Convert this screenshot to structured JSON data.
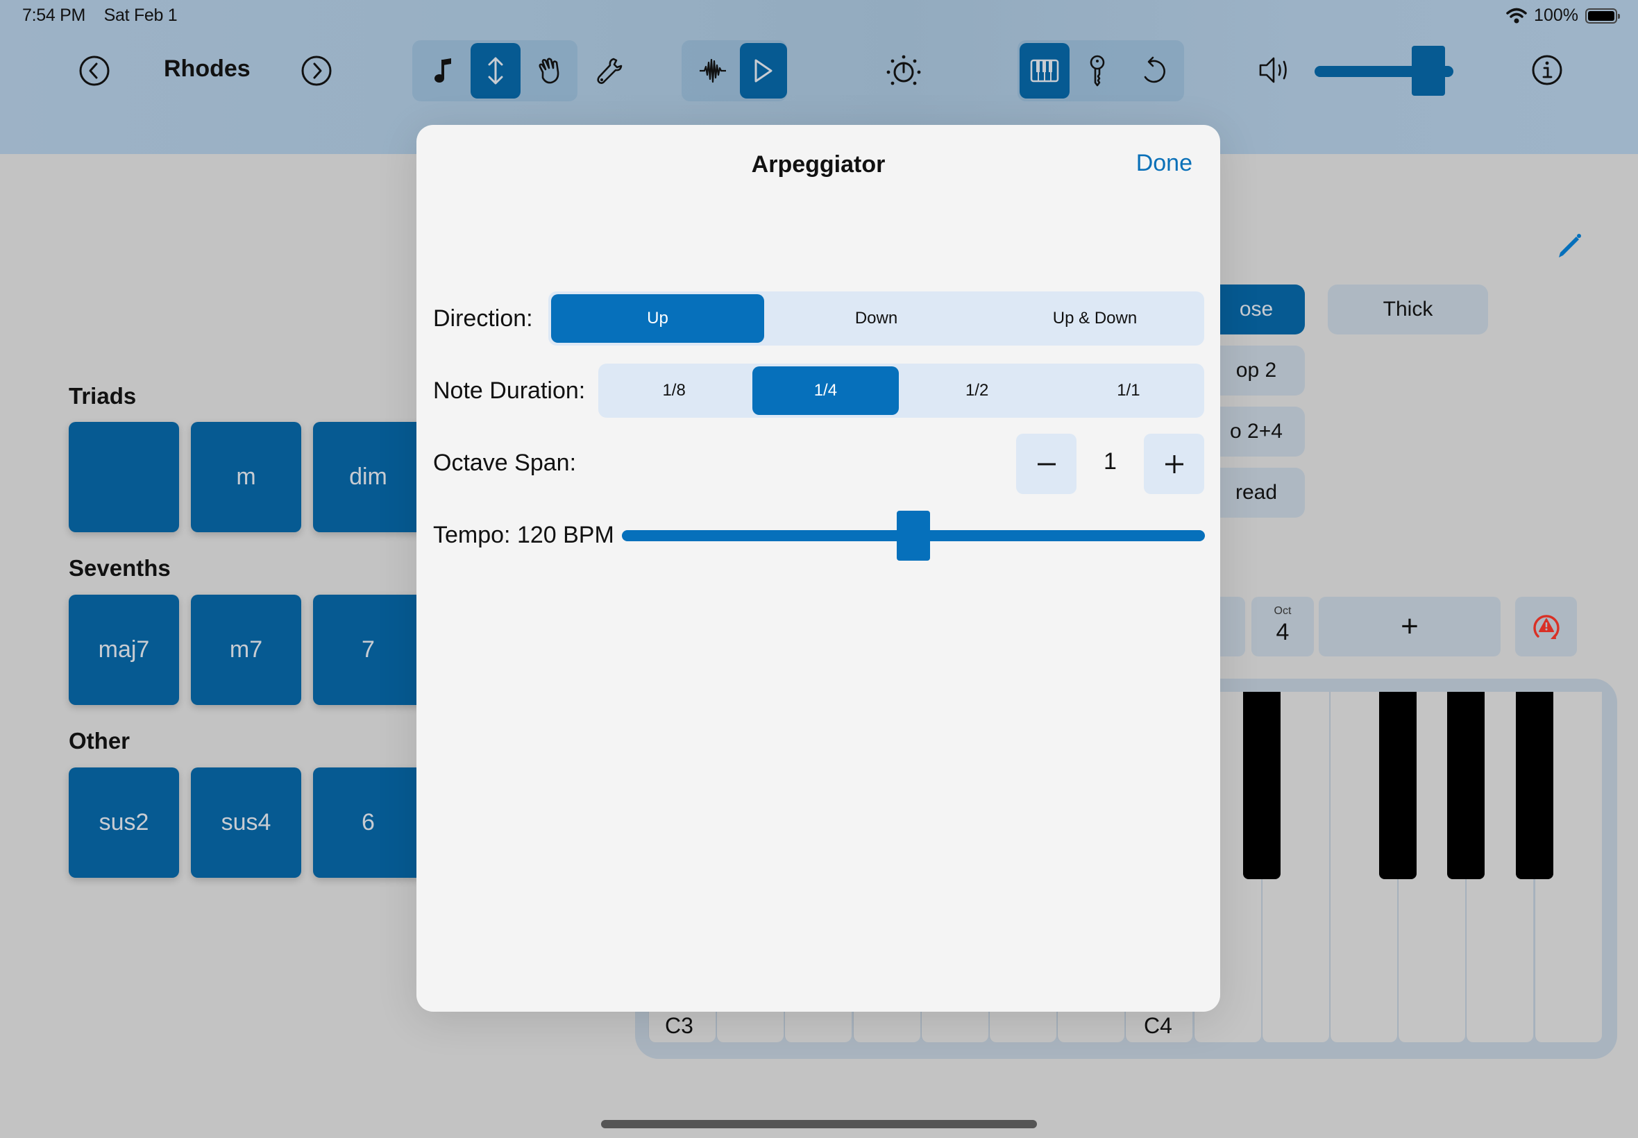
{
  "status_bar": {
    "time": "7:54 PM",
    "date": "Sat Feb 1",
    "battery": "100%",
    "icons": [
      "wifi-icon",
      "battery-icon"
    ]
  },
  "header": {
    "instrument_name": "Rhodes",
    "prev_icon": "chevron-left-circle-icon",
    "next_icon": "chevron-right-circle-icon",
    "mode_group": {
      "items": [
        "music-note-icon",
        "arrows-up-down-icon",
        "hand-icon"
      ],
      "selected_index": 1
    },
    "settings_icon": "wrench-icon",
    "play_group": {
      "items": [
        "waveform-icon",
        "play-icon"
      ],
      "selected_index": 1
    },
    "metronome_icon": "knob-icon",
    "view_group": {
      "items": [
        "piano-keys-icon",
        "key-icon",
        "undo-icon"
      ],
      "selected_index": 0
    },
    "volume_icon": "speaker-icon",
    "volume_level": 0.82,
    "info_icon": "info-circle-icon"
  },
  "chords": {
    "sections": [
      {
        "title": "Triads",
        "buttons": [
          "",
          "m",
          "dim"
        ]
      },
      {
        "title": "Sevenths",
        "buttons": [
          "maj7",
          "m7",
          "7"
        ]
      },
      {
        "title": "Other",
        "buttons": [
          "sus2",
          "sus4",
          "6"
        ]
      }
    ]
  },
  "voicings": {
    "edit_icon": "pencil-icon",
    "column1": [
      {
        "label": "ose",
        "selected": true
      },
      {
        "label": "op 2",
        "selected": false
      },
      {
        "label": "o 2+4",
        "selected": false
      },
      {
        "label": "read",
        "selected": false
      }
    ],
    "column2": [
      {
        "label": "Thick",
        "selected": false
      }
    ]
  },
  "octave_bar": {
    "oct_label": "Oct",
    "oct_value": "4",
    "add_label": "+",
    "warning_icon": "reset-warning-icon",
    "accent_color": "#d93025"
  },
  "keyboard": {
    "labels": [
      "C3",
      "C4"
    ]
  },
  "modal": {
    "title": "Arpeggiator",
    "done_label": "Done",
    "direction": {
      "label": "Direction:",
      "options": [
        "Up",
        "Down",
        "Up & Down"
      ],
      "selected_index": 0
    },
    "note_duration": {
      "label": "Note Duration:",
      "options": [
        "1/8",
        "1/4",
        "1/2",
        "1/1"
      ],
      "selected_index": 1
    },
    "octave_span": {
      "label": "Octave Span:",
      "value": "1",
      "minus_label": "−",
      "plus_label": "+"
    },
    "tempo": {
      "label": "Tempo: 120 BPM",
      "bpm": 120,
      "slider_fraction": 0.5
    }
  },
  "colors": {
    "accent": "#0670bb",
    "accent_dark": "#065a92",
    "done_link": "#0a70b8"
  }
}
